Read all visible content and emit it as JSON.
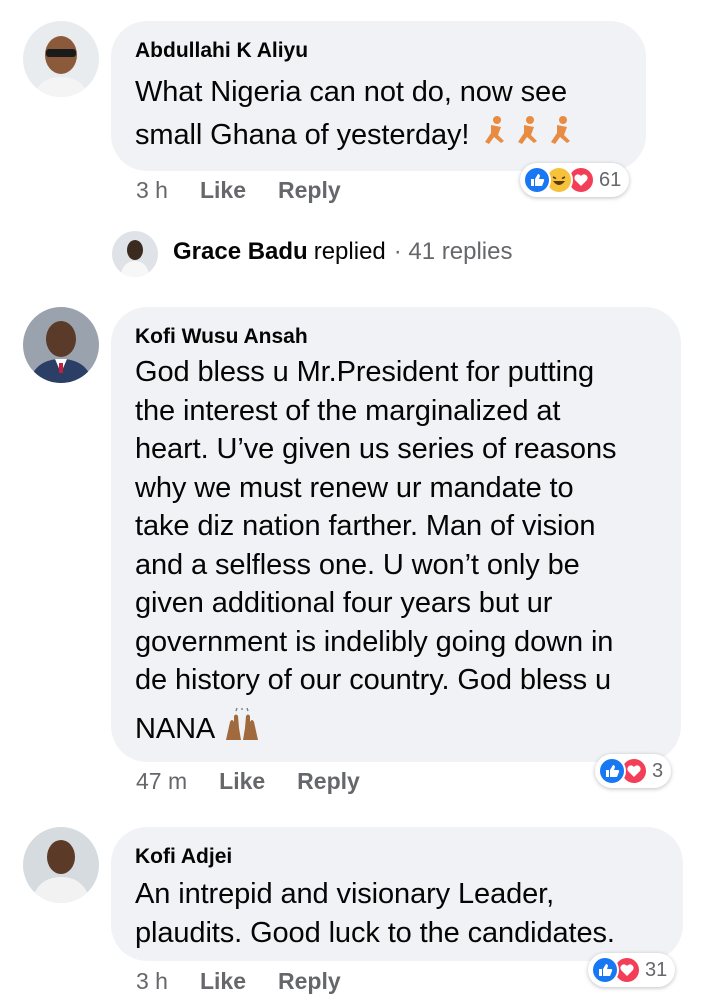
{
  "comments": [
    {
      "author": "Abdullahi K Aliyu",
      "lines": [
        "What Nigeria can not do, now see",
        "small Ghana of yesterday!"
      ],
      "time": "3 h",
      "like_label": "Like",
      "reply_label": "Reply",
      "reaction_count": "61",
      "reactions": [
        "like-icon",
        "haha-icon",
        "love-icon"
      ],
      "emoji": "running-person-emoji ×3"
    },
    {
      "author": "Kofi Wusu Ansah",
      "lines": [
        "God bless u Mr.President for putting",
        "the interest of the marginalized at",
        "heart. U’ve given us series of reasons",
        "why we must renew ur mandate to",
        "take diz nation farther. Man of vision",
        "and a selfless one. U won’t only be",
        "given additional four years but ur",
        "government is indelibly going down in",
        "de history of our country. God bless u",
        "NANA"
      ],
      "time": "47 m",
      "like_label": "Like",
      "reply_label": "Reply",
      "reaction_count": "3",
      "reactions": [
        "like-icon",
        "love-icon"
      ],
      "emoji": "raised-hands-emoji"
    },
    {
      "author": "Kofi Adjei",
      "lines": [
        "An intrepid and visionary Leader,",
        "plaudits. Good luck to the candidates."
      ],
      "time": "3 h",
      "like_label": "Like",
      "reply_label": "Reply",
      "reaction_count": "31",
      "reactions": [
        "like-icon",
        "love-icon"
      ]
    }
  ],
  "reply_thread": {
    "name": "Grace Badu",
    "text": "replied",
    "count": "· 41 replies"
  }
}
